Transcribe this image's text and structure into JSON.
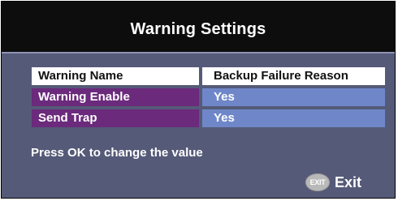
{
  "header": {
    "title": "Warning Settings"
  },
  "table": {
    "columns": [
      "Warning Name",
      "Backup Failure Reason"
    ],
    "rows": [
      {
        "name": "Warning Enable",
        "value": "Yes"
      },
      {
        "name": "Send Trap",
        "value": "Yes"
      }
    ]
  },
  "hint": "Press OK to change the value",
  "footer": {
    "exit_icon_text": "EXIT",
    "exit_label": "Exit"
  },
  "colors": {
    "header_bg": "#0d0d0d",
    "panel_bg": "#555a78",
    "name_cell_bg": "#6b2a7c",
    "value_cell_bg": "#6f87c9"
  },
  "icons": {
    "exit": "exit-button-icon"
  }
}
